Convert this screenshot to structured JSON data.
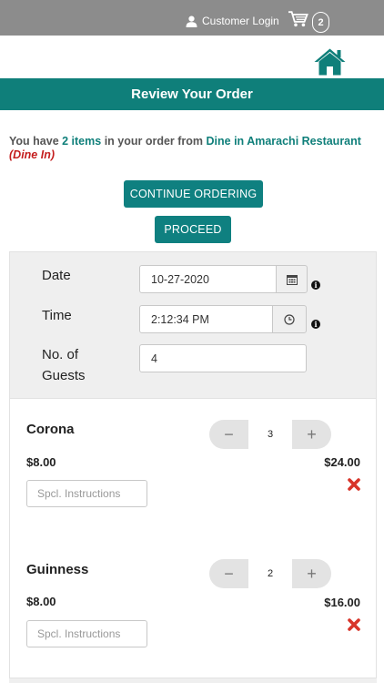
{
  "header": {
    "login_label": "Customer Login",
    "cart_count": "2"
  },
  "title": "Review Your Order",
  "summary": {
    "prefix": "You have ",
    "items_count": "2 items",
    "middle": " in your order from ",
    "restaurant": "Dine in Amarachi Restaurant",
    "mode": "(Dine In)"
  },
  "buttons": {
    "continue_label": "CONTINUE ORDERING",
    "proceed_label": "PROCEED"
  },
  "form": {
    "date_label": "Date",
    "date_value": "10-27-2020",
    "time_label": "Time",
    "time_value": "2:12:34 PM",
    "guests_label_line1": "No. of",
    "guests_label_line2": "Guests",
    "guests_value": "4"
  },
  "items": [
    {
      "name": "Corona",
      "price": "$8.00",
      "quantity": "3",
      "total": "$24.00",
      "instructions_placeholder": "Spcl. Instructions"
    },
    {
      "name": "Guinness",
      "price": "$8.00",
      "quantity": "2",
      "total": "$16.00",
      "instructions_placeholder": "Spcl. Instructions"
    }
  ],
  "stepper": {
    "minus_symbol": "−",
    "plus_symbol": "+"
  },
  "colors": {
    "brand": "#0f7f7a",
    "topbar": "#8c8c8c",
    "alert": "#c41e1e"
  },
  "icons": {
    "user": "user-icon",
    "cart": "cart-icon",
    "home": "home-icon",
    "calendar": "calendar-icon",
    "clock": "clock-icon",
    "info": "info-icon",
    "remove": "remove-icon"
  }
}
